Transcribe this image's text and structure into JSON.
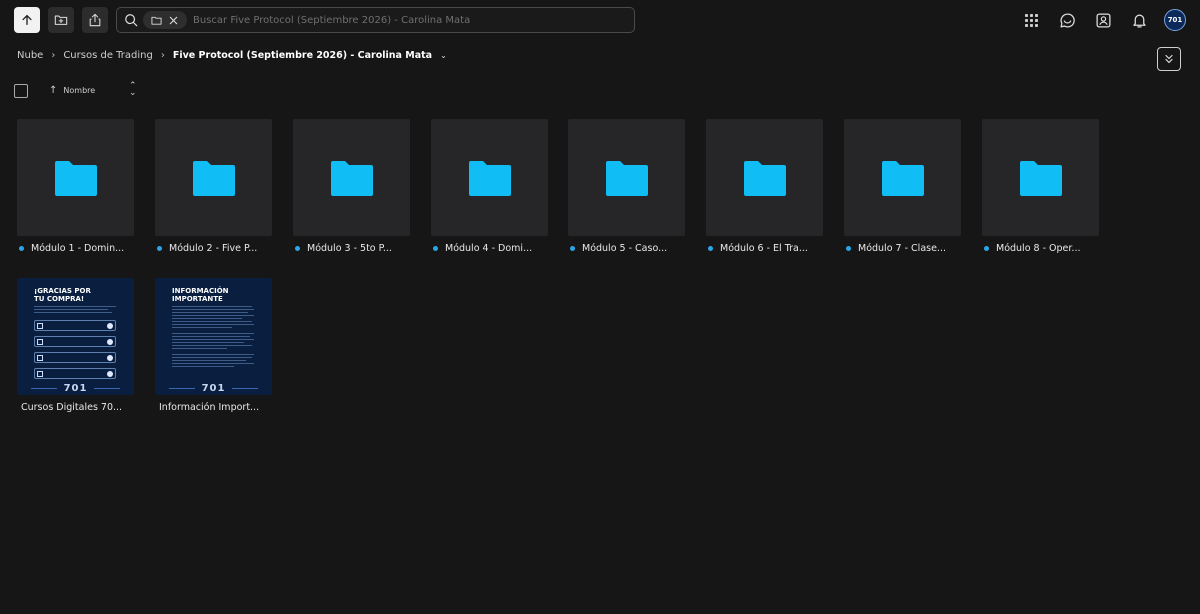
{
  "toolbar": {
    "upload_icon": "arrow-up-icon",
    "new_folder_icon": "folder-plus-icon",
    "share_icon": "share-icon"
  },
  "search": {
    "placeholder": "Buscar Five Protocol (Septiembre 2026) - Carolina Mata",
    "value": ""
  },
  "header_icons": [
    "apps-grid-icon",
    "chat-icon",
    "contacts-icon",
    "bell-icon"
  ],
  "avatar": {
    "label": "701"
  },
  "breadcrumb": {
    "items": [
      "Nube",
      "Cursos de Trading"
    ],
    "current": "Five Protocol (Septiembre 2026) - Carolina Mata"
  },
  "sort": {
    "label": "Nombre"
  },
  "folders": [
    {
      "name": "Módulo 1 - Domin..."
    },
    {
      "name": "Módulo 2 - Five P..."
    },
    {
      "name": "Módulo 3 - 5to P..."
    },
    {
      "name": "Módulo 4 - Domi..."
    },
    {
      "name": "Módulo 5 - Caso..."
    },
    {
      "name": "Módulo 6 - El Tra..."
    },
    {
      "name": "Módulo 7 - Clase..."
    },
    {
      "name": "Módulo 8 - Oper..."
    }
  ],
  "files": [
    {
      "name": "Cursos Digitales 70...",
      "thumb_title_1": "¡GRACIAS POR",
      "thumb_title_2": "TU COMPRA!",
      "thumb_brand": "701"
    },
    {
      "name": "Información Import...",
      "thumb_title_1": "INFORMACIÓN",
      "thumb_title_2": "IMPORTANTE",
      "thumb_brand": "701"
    }
  ],
  "colors": {
    "background": "#161616",
    "tile": "#262628",
    "folder": "#10bdf5",
    "dot": "#2aa6e8"
  }
}
